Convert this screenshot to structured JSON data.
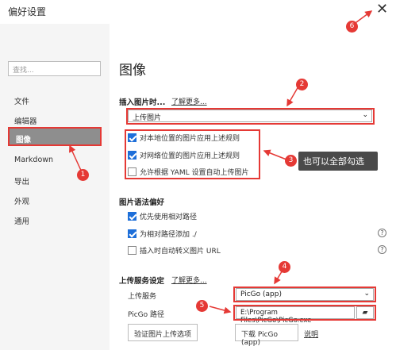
{
  "window": {
    "title": "偏好设置",
    "close_glyph": "✕"
  },
  "sidebar": {
    "search_placeholder": "查找...",
    "items": [
      {
        "label": "文件"
      },
      {
        "label": "编辑器"
      },
      {
        "label": "图像",
        "active": true
      },
      {
        "label": "Markdown"
      },
      {
        "label": "导出"
      },
      {
        "label": "外观"
      },
      {
        "label": "通用"
      }
    ]
  },
  "main": {
    "heading": "图像",
    "insert": {
      "title": "插入图片时...",
      "learn_more": "了解更多...",
      "selected": "上传图片",
      "checks": [
        {
          "label": "对本地位置的图片应用上述规则",
          "checked": true
        },
        {
          "label": "对网络位置的图片应用上述规则",
          "checked": true
        },
        {
          "label": "允许根据 YAML 设置自动上传图片",
          "checked": false
        }
      ]
    },
    "syntax": {
      "title": "图片语法偏好",
      "checks": [
        {
          "label": "优先使用相对路径",
          "checked": true
        },
        {
          "label": "为相对路径添加 ./",
          "checked": true
        },
        {
          "label": "插入时自动转义图片 URL",
          "checked": false
        }
      ]
    },
    "upload": {
      "title": "上传服务设定",
      "learn_more": "了解更多...",
      "service_label": "上传服务",
      "service_value": "PicGo (app)",
      "path_label": "PicGo 路径",
      "path_value": "E:\\Program Files\\PicGo\\PicGo.exe",
      "verify_button": "验证图片上传选项",
      "download_button": "下载 PicGo (app)",
      "explain_link": "说明"
    }
  },
  "annotations": {
    "badges": [
      "1",
      "2",
      "3",
      "4",
      "5",
      "6"
    ],
    "tooltip": "也可以全部勾选",
    "color": "#e53935"
  }
}
